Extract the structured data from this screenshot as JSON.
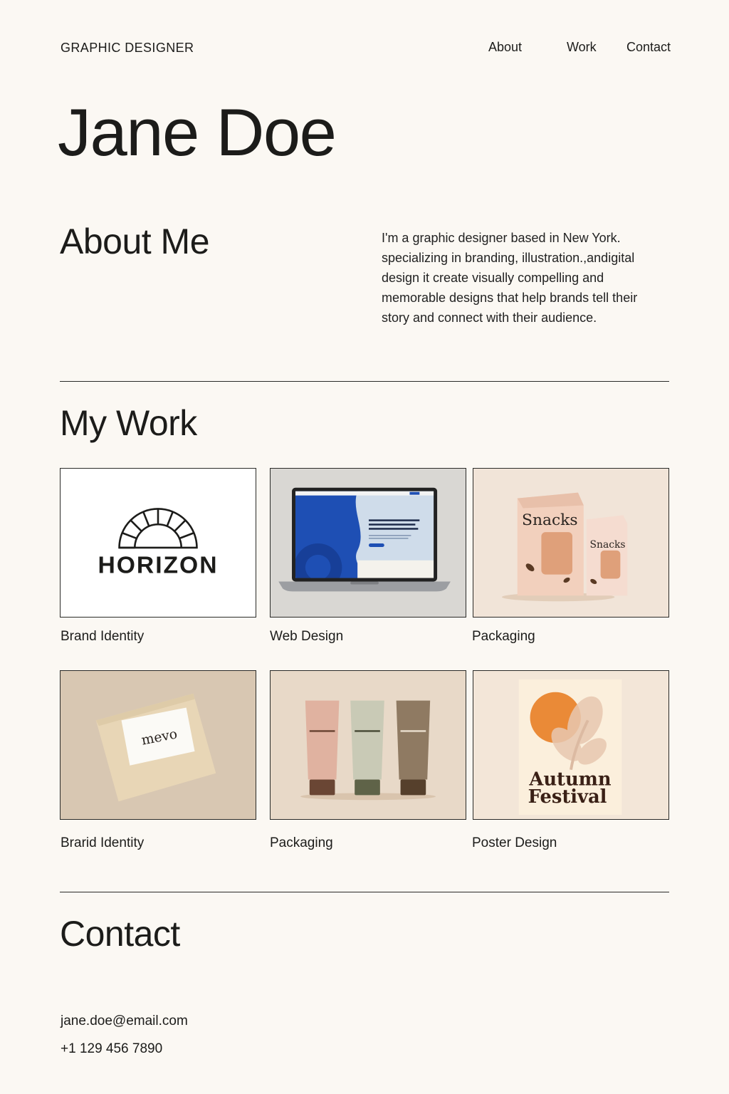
{
  "header": {
    "tagline": "GRAPHIC DESIGNER",
    "nav": [
      "About",
      "Work",
      "Contact"
    ]
  },
  "hero": {
    "name": "Jane Doe"
  },
  "about": {
    "title": "About Me",
    "body": "I'm a graphic designer based in New York. specializing in branding, illustration.,andigital design it create visually compelling and memorable designs that help brands tell their story and connect with their audience."
  },
  "work": {
    "title": "My Work",
    "items": [
      {
        "caption": "Brand Identity",
        "image_text": "HORIZON"
      },
      {
        "caption": "Web Design"
      },
      {
        "caption": "Packaging",
        "image_text": "Snacks"
      },
      {
        "caption": "Brarid Identity",
        "image_text": "mevo"
      },
      {
        "caption": "Packaging"
      },
      {
        "caption": "Poster Design",
        "image_text": [
          "Autumn",
          "Festival"
        ]
      }
    ]
  },
  "contact": {
    "title": "Contact",
    "email": "jane.doe@email.com",
    "phone": "+1 129 456 7890"
  },
  "colors": {
    "background": "#fbf8f3",
    "text": "#1c1c1a",
    "accent_blue": "#1e4fb4",
    "accent_orange": "#ea8a37"
  }
}
